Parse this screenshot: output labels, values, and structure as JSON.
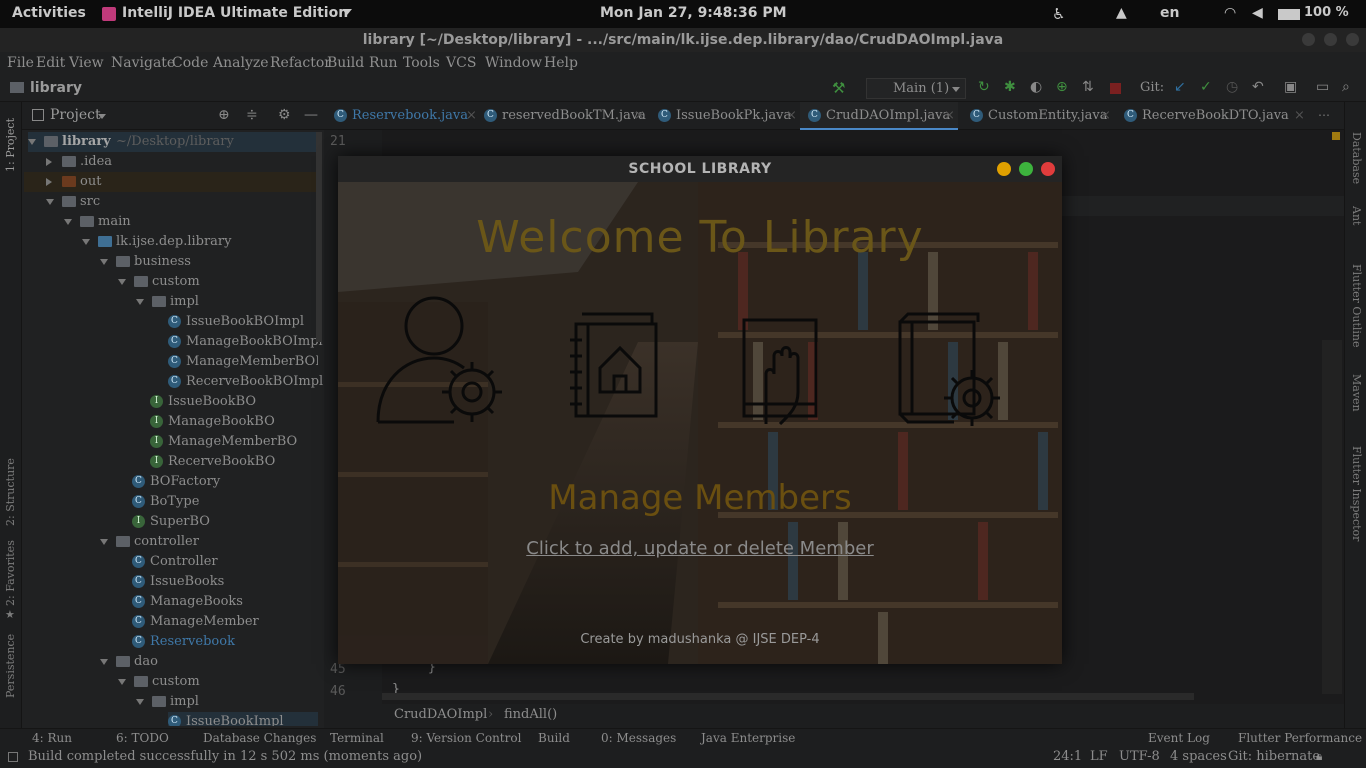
{
  "system": {
    "activities": "Activities",
    "app_name": "IntelliJ IDEA Ultimate Edition",
    "clock": "Mon Jan 27,  9:48:36 PM",
    "language": "en",
    "battery": "100 %"
  },
  "window": {
    "title": "library [~/Desktop/library] - .../src/main/lk.ijse.dep.library/dao/CrudDAOImpl.java"
  },
  "menu": [
    "File",
    "Edit",
    "View",
    "Navigate",
    "Code",
    "Analyze",
    "Refactor",
    "Build",
    "Run",
    "Tools",
    "VCS",
    "Window",
    "Help"
  ],
  "navbar": {
    "project": "library",
    "run_config": "Main (1)",
    "git_label": "Git:"
  },
  "project_panel": {
    "title": "Project",
    "tree": [
      {
        "label": "library",
        "extra": "~/Desktop/library"
      },
      {
        "label": ".idea"
      },
      {
        "label": "out"
      },
      {
        "label": "src"
      },
      {
        "label": "main"
      },
      {
        "label": "lk.ijse.dep.library"
      },
      {
        "label": "business"
      },
      {
        "label": "custom"
      },
      {
        "label": "impl"
      },
      {
        "label": "IssueBookBOImpl"
      },
      {
        "label": "ManageBookBOImpl"
      },
      {
        "label": "ManageMemberBOImpl"
      },
      {
        "label": "RecerveBookBOImpl"
      },
      {
        "label": "IssueBookBO"
      },
      {
        "label": "ManageBookBO"
      },
      {
        "label": "ManageMemberBO"
      },
      {
        "label": "RecerveBookBO"
      },
      {
        "label": "BOFactory"
      },
      {
        "label": "BoType"
      },
      {
        "label": "SuperBO"
      },
      {
        "label": "controller"
      },
      {
        "label": "Controller"
      },
      {
        "label": "IssueBooks"
      },
      {
        "label": "ManageBooks"
      },
      {
        "label": "ManageMember"
      },
      {
        "label": "Reservebook"
      },
      {
        "label": "dao"
      },
      {
        "label": "custom"
      },
      {
        "label": "impl"
      },
      {
        "label": "IssueBookImpl"
      }
    ]
  },
  "left_tool_tabs": [
    "1: Project",
    "2: Structure",
    "2: Favorites",
    "Persistence"
  ],
  "right_tool_tabs": [
    "Database",
    "Ant",
    "Flutter Outline",
    "Maven",
    "Flutter Inspector"
  ],
  "editor_tabs": [
    "Reservebook.java",
    "reservedBookTM.java",
    "IssueBookPk.java",
    "CrudDAOImpl.java",
    "CustomEntity.java",
    "RecerveBookDTO.java"
  ],
  "editor": {
    "line_numbers": [
      "21",
      "45",
      "46"
    ],
    "code_brace_1": "}",
    "code_brace_2": "}"
  },
  "breadcrumb": [
    "CrudDAOImpl",
    "findAll()"
  ],
  "tool_windows": [
    "4: Run",
    "6: TODO",
    "Database Changes",
    "Terminal",
    "9: Version Control",
    "Build",
    "0: Messages",
    "Java Enterprise",
    "Event Log",
    "Flutter Performance"
  ],
  "status": {
    "message": "Build completed successfully in 12 s 502 ms (moments ago)",
    "position": "24:1",
    "line_sep": "LF",
    "encoding": "UTF-8",
    "indent": "4 spaces",
    "git_branch": "Git: hibernate"
  },
  "dialog": {
    "title": "SCHOOL LIBRARY",
    "welcome": "Welcome To Library",
    "heading": "Manage Members",
    "link": "Click to add, update or delete Member",
    "credit": "Create by madushanka @ IJSE DEP-4",
    "icons": [
      "member-settings-icon",
      "book-home-icon",
      "book-hand-icon",
      "book-settings-icon"
    ],
    "btn_colors": [
      "#e0a000",
      "#3db33d",
      "#e03c3c"
    ]
  }
}
